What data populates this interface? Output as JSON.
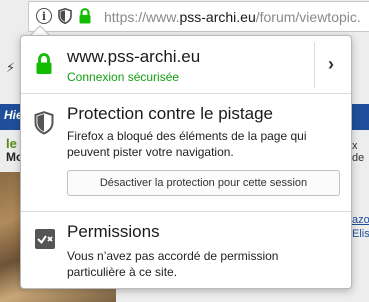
{
  "browser": {
    "url_prefix": "https://www.",
    "url_domain": "pss-archi.eu",
    "url_path": "/forum/viewtopic."
  },
  "background_page": {
    "banner_text": "Hie",
    "green_text": "le",
    "dark_text": "Mo",
    "right_text_1": "x de",
    "right_link_1": "azor",
    "right_link_2": "Elis"
  },
  "identity_popup": {
    "site": {
      "host": "www.pss-archi.eu",
      "status": "Connexion sécurisée",
      "status_color": "#12a012"
    },
    "tracking": {
      "title": "Protection contre le pistage",
      "description": "Firefox a bloqué des éléments de la page qui peuvent pister votre navigation.",
      "disable_button": "Désactiver la protection pour cette session"
    },
    "permissions": {
      "title": "Permissions",
      "description": "Vous n’avez pas accordé de permission particulière à ce site."
    }
  }
}
